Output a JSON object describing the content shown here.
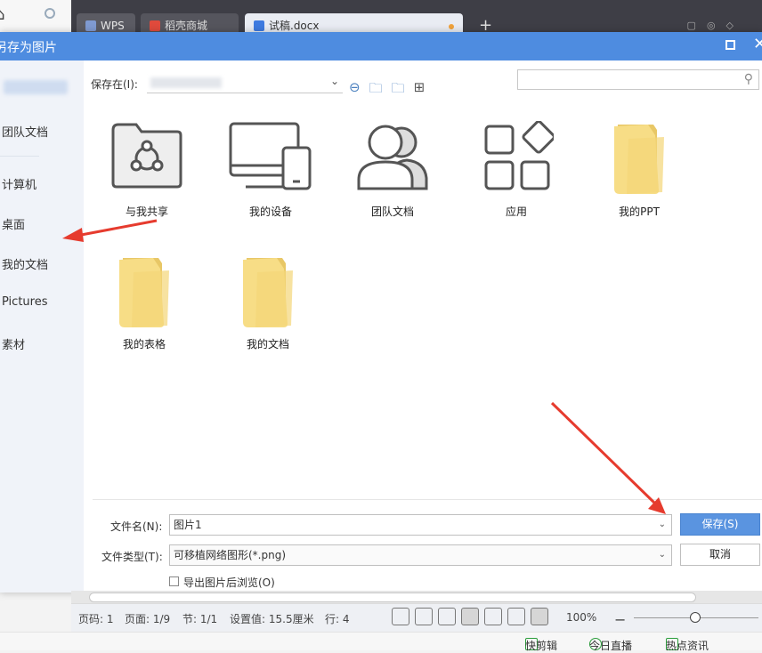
{
  "browser": {
    "home_icon": "home-icon"
  },
  "tabs": [
    {
      "label": "WPS",
      "icon": "wps-logo-icon",
      "color": "#7f9ad1"
    },
    {
      "label": "稻壳商城",
      "icon": "flame-icon",
      "color": "#e04a3c"
    },
    {
      "label": "试稿.docx",
      "icon": "word-doc-icon",
      "color": "#3e7ae0"
    }
  ],
  "dialog": {
    "title": "另存为图片",
    "sidebar": [
      {
        "label": "团队文档"
      },
      {
        "label": "计算机"
      },
      {
        "label": "桌面"
      },
      {
        "label": "我的文档"
      },
      {
        "label": "Pictures"
      },
      {
        "label": "素材"
      }
    ],
    "save_in_label": "保存在(I):",
    "search_placeholder": "",
    "grid": [
      {
        "label": "与我共享",
        "icon": "shared-with-me-icon"
      },
      {
        "label": "我的设备",
        "icon": "my-devices-icon"
      },
      {
        "label": "团队文档",
        "icon": "team-docs-icon"
      },
      {
        "label": "应用",
        "icon": "apps-icon"
      },
      {
        "label": "我的PPT",
        "icon": "folder-icon"
      },
      {
        "label": "我的表格",
        "icon": "folder-icon"
      },
      {
        "label": "我的文档",
        "icon": "folder-icon"
      }
    ],
    "filename_label": "文件名(N):",
    "filename_value": "图片1",
    "filetype_label": "文件类型(T):",
    "filetype_value": "可移植网络图形(*.png)",
    "save_button": "保存(S)",
    "cancel_button": "取消",
    "checkbox_label": "导出图片后浏览(O)",
    "accent_color": "#4e8ce0"
  },
  "statusbar": {
    "page_code": "页码: 1",
    "page": "页面: 1/9",
    "section": "节: 1/1",
    "position": "设置值: 15.5厘米",
    "line": "行: 4",
    "zoom": "100%"
  },
  "taskbar": {
    "items": [
      "快剪辑",
      "今日直播",
      "热点资讯"
    ]
  }
}
